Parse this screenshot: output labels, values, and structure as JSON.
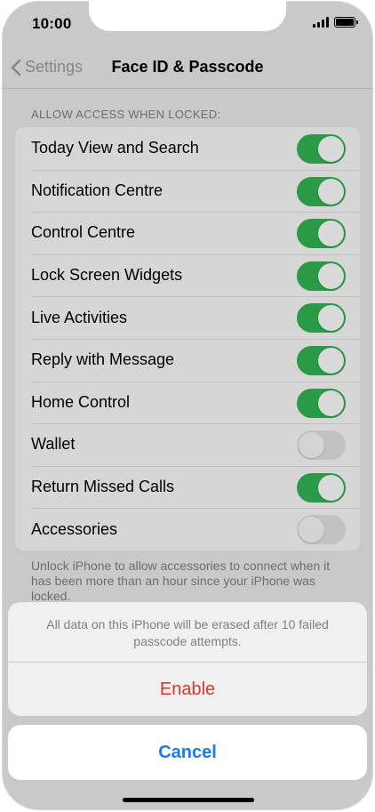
{
  "status_bar": {
    "time": "10:00"
  },
  "nav": {
    "back_label": "Settings",
    "title": "Face ID & Passcode"
  },
  "section": {
    "header": "ALLOW ACCESS WHEN LOCKED:",
    "items": [
      {
        "label": "Today View and Search",
        "on": true
      },
      {
        "label": "Notification Centre",
        "on": true
      },
      {
        "label": "Control Centre",
        "on": true
      },
      {
        "label": "Lock Screen Widgets",
        "on": true
      },
      {
        "label": "Live Activities",
        "on": true
      },
      {
        "label": "Reply with Message",
        "on": true
      },
      {
        "label": "Home Control",
        "on": true
      },
      {
        "label": "Wallet",
        "on": false
      },
      {
        "label": "Return Missed Calls",
        "on": true
      },
      {
        "label": "Accessories",
        "on": false
      }
    ],
    "footer": "Unlock iPhone to allow accessories to connect when it has been more than an hour since your iPhone was locked."
  },
  "action_sheet": {
    "message": "All data on this iPhone will be erased after 10 failed passcode attempts.",
    "enable_label": "Enable",
    "cancel_label": "Cancel"
  },
  "colors": {
    "toggle_on": "#2b9a46",
    "destructive": "#e0332b",
    "tint": "#1a7ae8"
  }
}
